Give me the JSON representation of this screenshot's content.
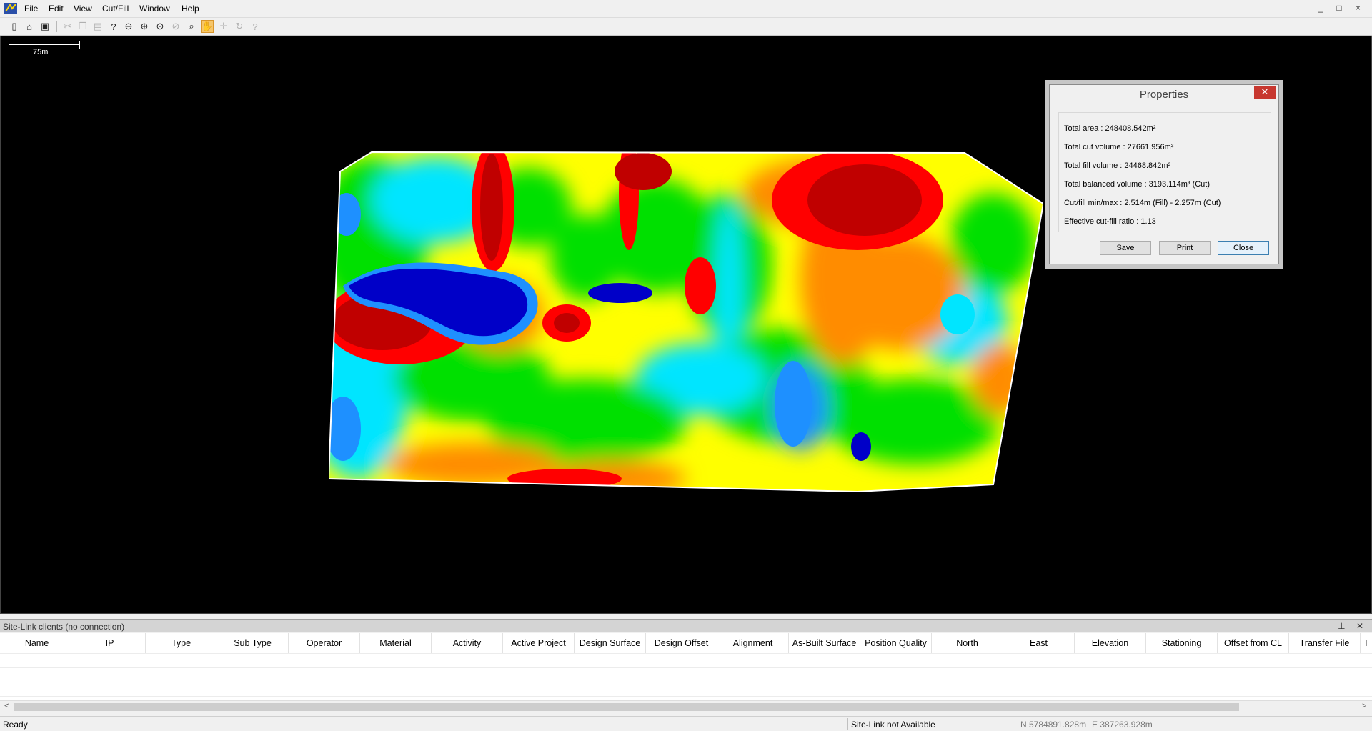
{
  "menu": [
    "File",
    "Edit",
    "View",
    "Cut/Fill",
    "Window",
    "Help"
  ],
  "window_controls": "_ □ ×",
  "toolbar_icons": [
    "new-file-icon",
    "open-folder-icon",
    "save-icon",
    "cut-icon",
    "copy-icon",
    "paste-icon",
    "help-icon",
    "zoom-out-icon",
    "zoom-in-icon",
    "zoom-extents-icon",
    "zoom-previous-icon",
    "zoom-window-icon",
    "pan-hand-icon",
    "crosshair-icon",
    "rotate-icon",
    "about-icon"
  ],
  "canvas": {
    "scale_label": "75m"
  },
  "properties": {
    "title": "Properties",
    "close_glyph": "✕",
    "lines": [
      "Total area : 248408.542m²",
      "Total cut volume : 27661.956m³",
      "Total fill volume : 24468.842m³",
      "Total balanced volume : 3193.114m³ (Cut)",
      "Cut/fill min/max : 2.514m (Fill) - 2.257m (Cut)",
      "Effective cut-fill ratio : 1.13"
    ],
    "buttons": {
      "save": "Save",
      "print": "Print",
      "close": "Close"
    }
  },
  "colors": {
    "cut_high": "#c00000",
    "cut": "#ff0000",
    "cut_low": "#ff8c00",
    "near_zero": "#ffff00",
    "fill_low": "#00e000",
    "fill": "#00e5ff",
    "fill_mid": "#1e90ff",
    "fill_high": "#0000c8"
  },
  "sitelink": {
    "title": "Site-Link clients (no connection)",
    "panel_controls": "⊥ ✕",
    "columns": [
      "Name",
      "IP",
      "Type",
      "Sub Type",
      "Operator",
      "Material",
      "Activity",
      "Active Project",
      "Design Surface",
      "Design Offset",
      "Alignment",
      "As-Built Surface",
      "Position Quality",
      "North",
      "East",
      "Elevation",
      "Stationing",
      "Offset from CL",
      "Transfer File",
      "T"
    ]
  },
  "status": {
    "ready": "Ready",
    "sitelink": "Site-Link not Available",
    "north": "N 5784891.828m",
    "east": "E 387263.928m"
  }
}
